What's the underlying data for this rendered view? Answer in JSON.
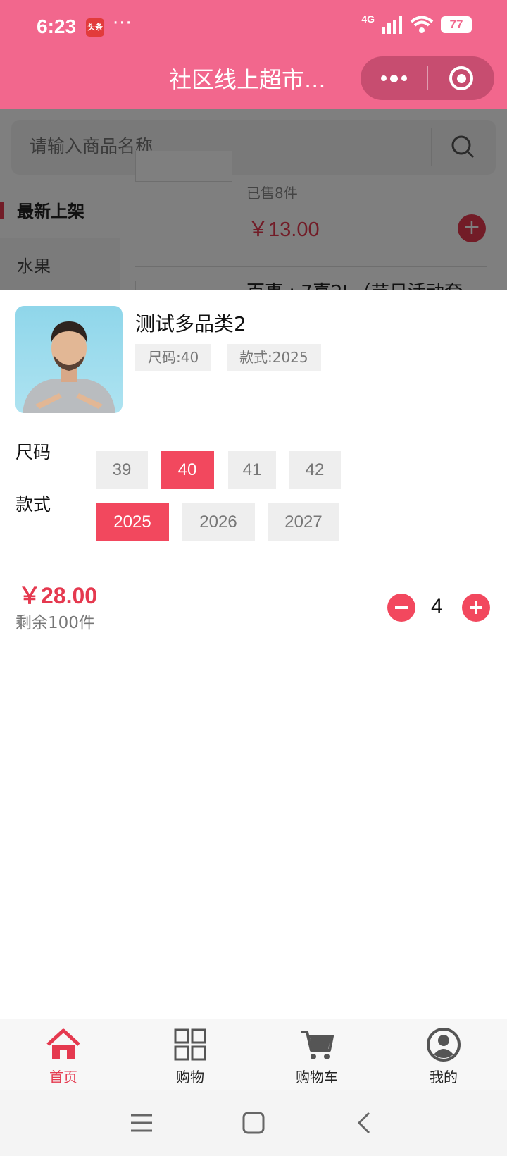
{
  "status_bar": {
    "time": "6:23",
    "app_badge": "头条",
    "more": "···",
    "network": "4G",
    "battery": "77"
  },
  "header": {
    "title": "社区线上超市..."
  },
  "colors": {
    "header_bg": "#f2678d",
    "accent": "#e5394f",
    "chip_selected": "#f2485e"
  },
  "background_page": {
    "search": {
      "placeholder": "请输入商品名称"
    },
    "categories": [
      {
        "label": "最新上架",
        "active": true
      },
      {
        "label": "水果",
        "active": false
      }
    ],
    "product_sold": "已售8件",
    "product_price": "￥13.00",
    "next_product_title": "百事 : 7喜2L（节日活动套"
  },
  "product_sheet": {
    "name": "测试多品类2",
    "selected_tags": [
      "尺码:40",
      "款式:2025"
    ],
    "options": [
      {
        "label": "尺码",
        "values": [
          "39",
          "40",
          "41",
          "42"
        ],
        "selected": "40"
      },
      {
        "label": "款式",
        "values": [
          "2025",
          "2026",
          "2027"
        ],
        "selected": "2025"
      }
    ],
    "price": "￥28.00",
    "stock": "剩余100件",
    "quantity": "4"
  },
  "tabbar": {
    "items": [
      {
        "label": "首页",
        "icon": "home-icon",
        "active": true
      },
      {
        "label": "购物",
        "icon": "grid-icon",
        "active": false
      },
      {
        "label": "购物车",
        "icon": "cart-icon",
        "active": false
      },
      {
        "label": "我的",
        "icon": "user-icon",
        "active": false
      }
    ]
  }
}
